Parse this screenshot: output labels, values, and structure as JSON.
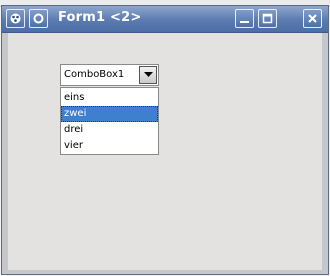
{
  "window": {
    "title": "Form1 <2>",
    "icons": {
      "app": "app-menu-icon",
      "pin": "sticky-icon",
      "minimize": "minimize-icon",
      "maximize": "maximize-icon",
      "close": "close-icon"
    }
  },
  "combobox": {
    "value": "ComboBox1",
    "arrow_icon": "chevron-down-icon"
  },
  "dropdown": {
    "items": [
      "eins",
      "zwei",
      "drei",
      "vier"
    ],
    "selected": "zwei"
  },
  "colors": {
    "titlebar": "#5a7bb0",
    "selection": "#3f7fd0",
    "client": "#e4e2e1"
  }
}
